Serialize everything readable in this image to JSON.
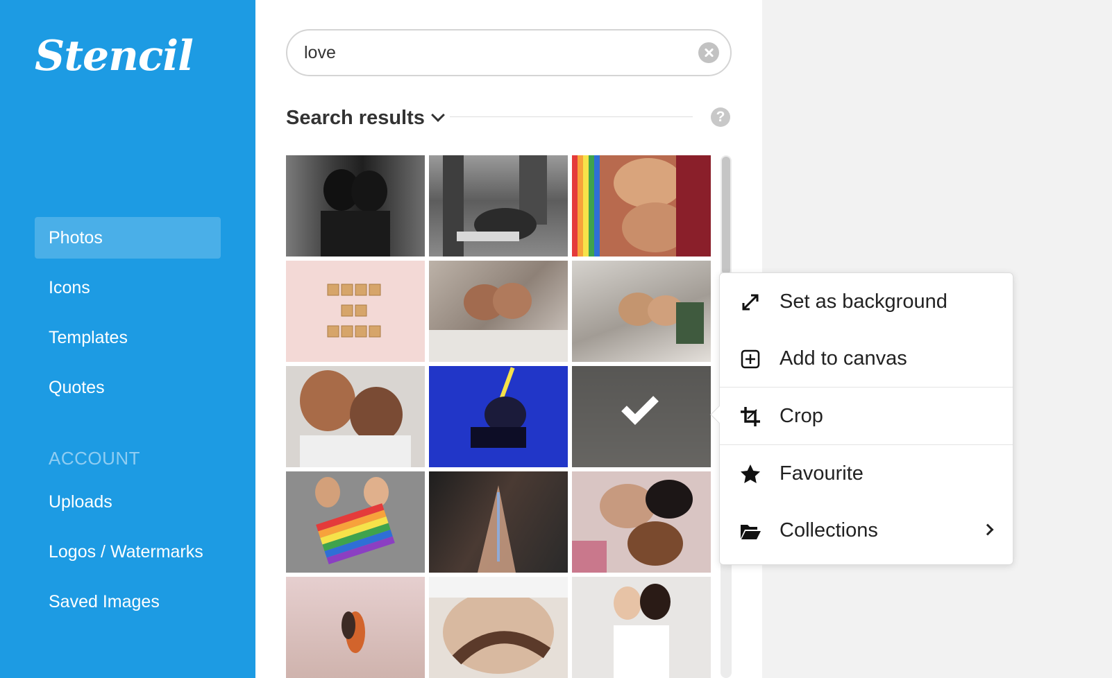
{
  "sidebar": {
    "logo": "Stencil",
    "items": [
      {
        "label": "Photos",
        "active": true
      },
      {
        "label": "Icons"
      },
      {
        "label": "Templates"
      },
      {
        "label": "Quotes"
      }
    ],
    "account_heading": "ACCOUNT",
    "account_items": [
      {
        "label": "Uploads"
      },
      {
        "label": "Logos / Watermarks"
      },
      {
        "label": "Saved Images"
      }
    ]
  },
  "search": {
    "value": "love",
    "placeholder": ""
  },
  "results": {
    "title": "Search results",
    "help": "?"
  },
  "grid": {
    "tiles": [
      {
        "name": "photo-couple-forehead-bw",
        "selected": false
      },
      {
        "name": "photo-men-sitting-tree-bw",
        "selected": false
      },
      {
        "name": "photo-couple-lying-rainbow",
        "selected": false
      },
      {
        "name": "photo-love-is-love-tiles",
        "selected": false
      },
      {
        "name": "photo-couple-bed-1",
        "selected": false
      },
      {
        "name": "photo-couple-bed-2",
        "selected": false
      },
      {
        "name": "photo-women-cheek-to-cheek",
        "selected": false
      },
      {
        "name": "photo-person-blue-rainbow",
        "selected": false
      },
      {
        "name": "photo-couple-field",
        "selected": true
      },
      {
        "name": "photo-men-rainbow-sign",
        "selected": false
      },
      {
        "name": "photo-hands-rainbow-light",
        "selected": false
      },
      {
        "name": "photo-women-lying-pink",
        "selected": false
      },
      {
        "name": "photo-couple-beach",
        "selected": false
      },
      {
        "name": "photo-hands-on-belly",
        "selected": false
      },
      {
        "name": "photo-women-embracing",
        "selected": false
      }
    ]
  },
  "context_menu": {
    "items": [
      {
        "label": "Set as background",
        "icon": "expand-icon"
      },
      {
        "label": "Add to canvas",
        "icon": "plus-square-icon"
      },
      {
        "label": "Crop",
        "icon": "crop-icon"
      },
      {
        "label": "Favourite",
        "icon": "star-icon"
      },
      {
        "label": "Collections",
        "icon": "folder-open-icon"
      }
    ]
  },
  "colors": {
    "sidebar": "#1d9be3",
    "panel": "#ffffff",
    "canvas": "#f2f2f2"
  }
}
